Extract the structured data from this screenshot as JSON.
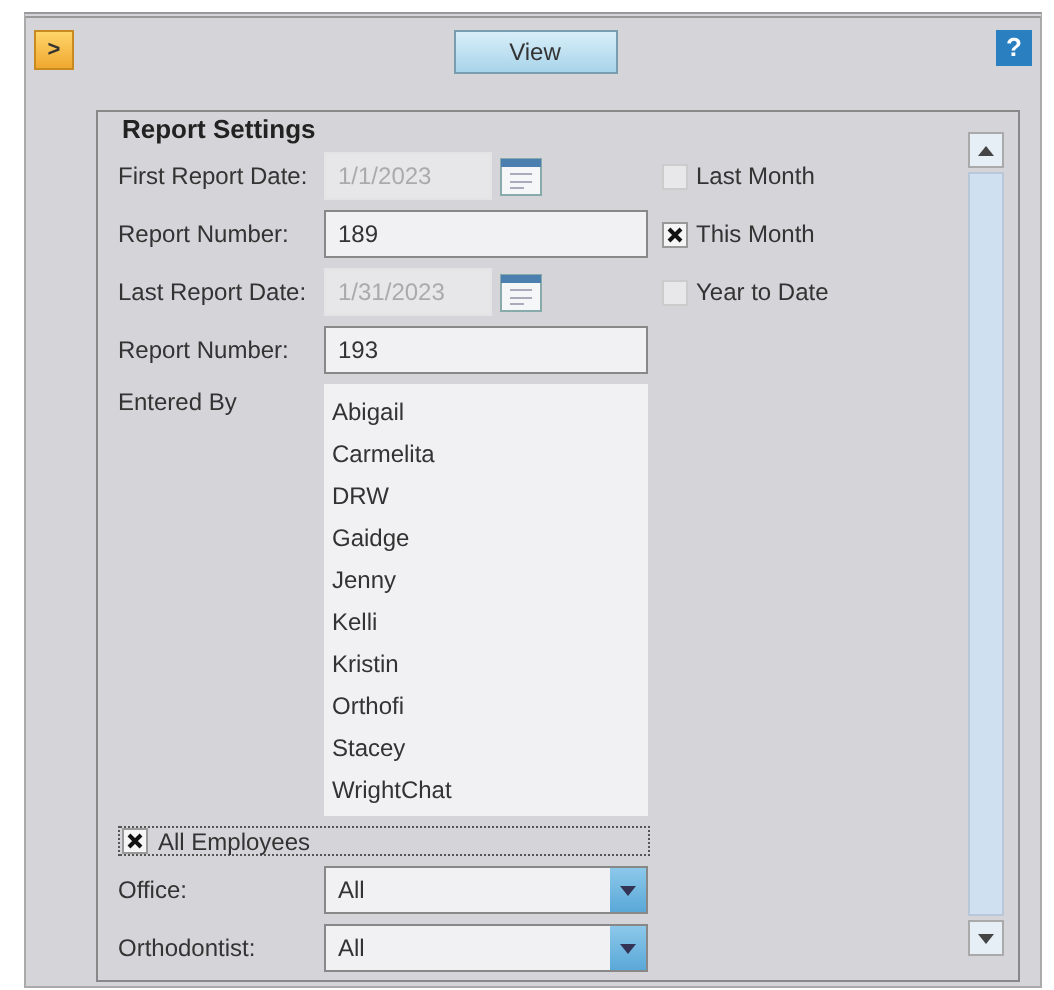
{
  "toolbar": {
    "expand_button": ">",
    "view_button": "View",
    "help_button": "?"
  },
  "report_settings": {
    "title": "Report Settings",
    "rows": [
      {
        "kind": "date",
        "label": "First Report Date:",
        "value": "1/1/2023",
        "disabled": true,
        "option": {
          "label": "Last Month",
          "checked": false
        }
      },
      {
        "kind": "text",
        "label": "Report Number:",
        "value": "189",
        "disabled": false,
        "option": {
          "label": "This Month",
          "checked": true
        }
      },
      {
        "kind": "date",
        "label": "Last Report Date:",
        "value": "1/31/2023",
        "disabled": true,
        "option": {
          "label": "Year to Date",
          "checked": false
        }
      },
      {
        "kind": "text",
        "label": "Report Number:",
        "value": "193",
        "disabled": false
      },
      {
        "kind": "list",
        "label": "Entered By",
        "items": [
          "Abigail",
          "Carmelita",
          "DRW",
          "Gaidge",
          "Jenny",
          "Kelli",
          "Kristin",
          "Orthofi",
          "Stacey",
          "WrightChat"
        ]
      }
    ],
    "all_employees": {
      "label": "All Employees",
      "checked": true
    },
    "dropdowns": [
      {
        "label": "Office:",
        "value": "All"
      },
      {
        "label": "Orthodontist:",
        "value": "All"
      }
    ]
  }
}
